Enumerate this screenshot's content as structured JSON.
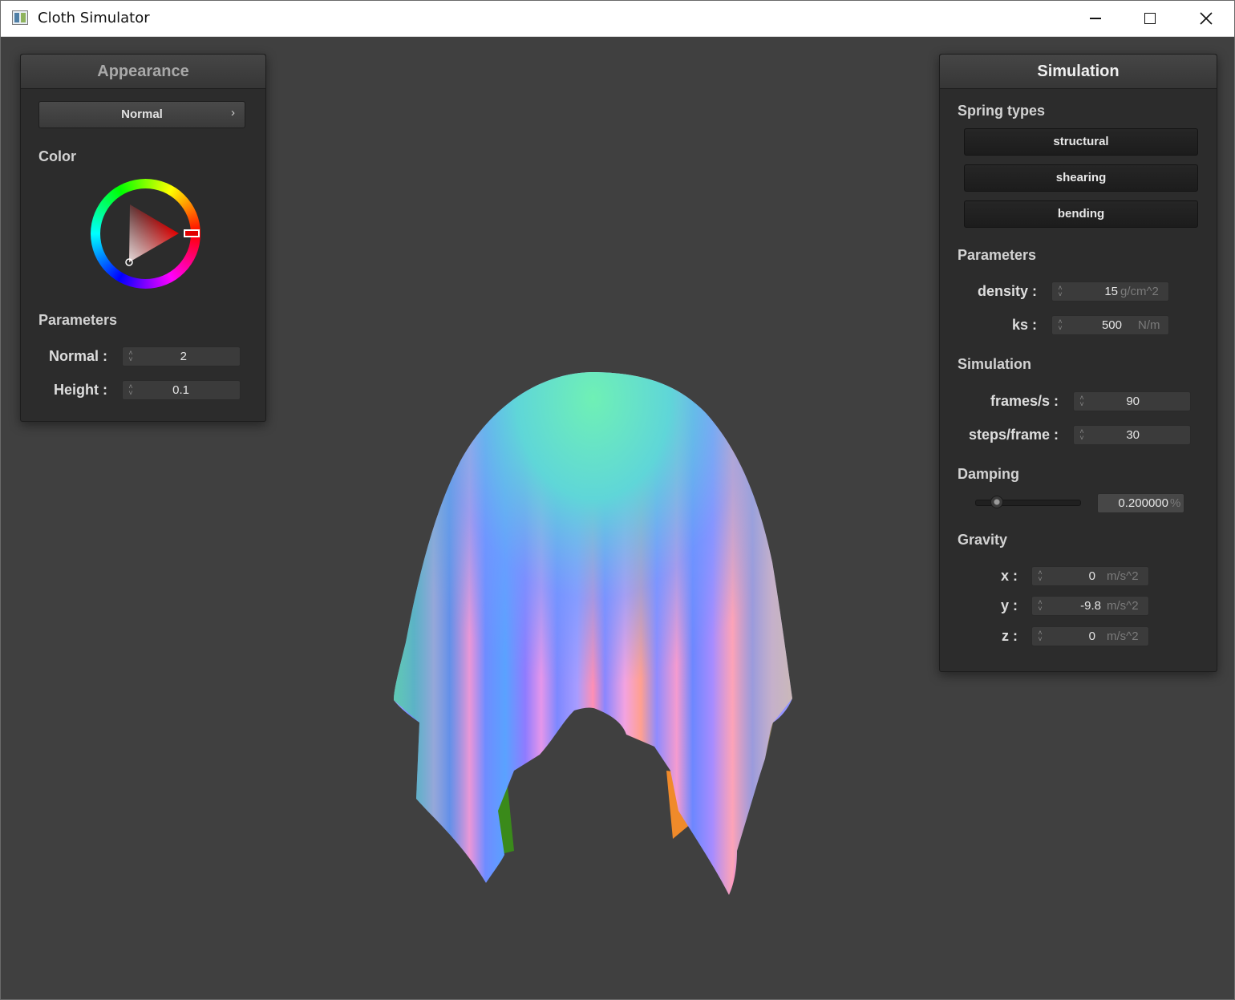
{
  "window": {
    "title": "Cloth Simulator"
  },
  "appearance": {
    "title": "Appearance",
    "shader_selected": "Normal",
    "color_label": "Color",
    "selected_color": "#e00000",
    "params_label": "Parameters",
    "normal_label": "Normal :",
    "normal_value": "2",
    "height_label": "Height :",
    "height_value": "0.1"
  },
  "simulation": {
    "title": "Simulation",
    "spring_types_label": "Spring types",
    "spring_buttons": [
      "structural",
      "shearing",
      "bending"
    ],
    "params_label": "Parameters",
    "density": {
      "label": "density :",
      "value": "15",
      "unit": "g/cm^2"
    },
    "ks": {
      "label": "ks :",
      "value": "500",
      "unit": "N/m"
    },
    "sim_label": "Simulation",
    "fps": {
      "label": "frames/s :",
      "value": "90"
    },
    "steps": {
      "label": "steps/frame :",
      "value": "30"
    },
    "damping_label": "Damping",
    "damping": {
      "value": "0.200000",
      "unit": "%",
      "slider_fraction": 0.2
    },
    "gravity_label": "Gravity",
    "gravity": [
      {
        "label": "x :",
        "value": "0",
        "unit": "m/s^2"
      },
      {
        "label": "y :",
        "value": "-9.8",
        "unit": "m/s^2"
      },
      {
        "label": "z :",
        "value": "0",
        "unit": "m/s^2"
      }
    ]
  }
}
